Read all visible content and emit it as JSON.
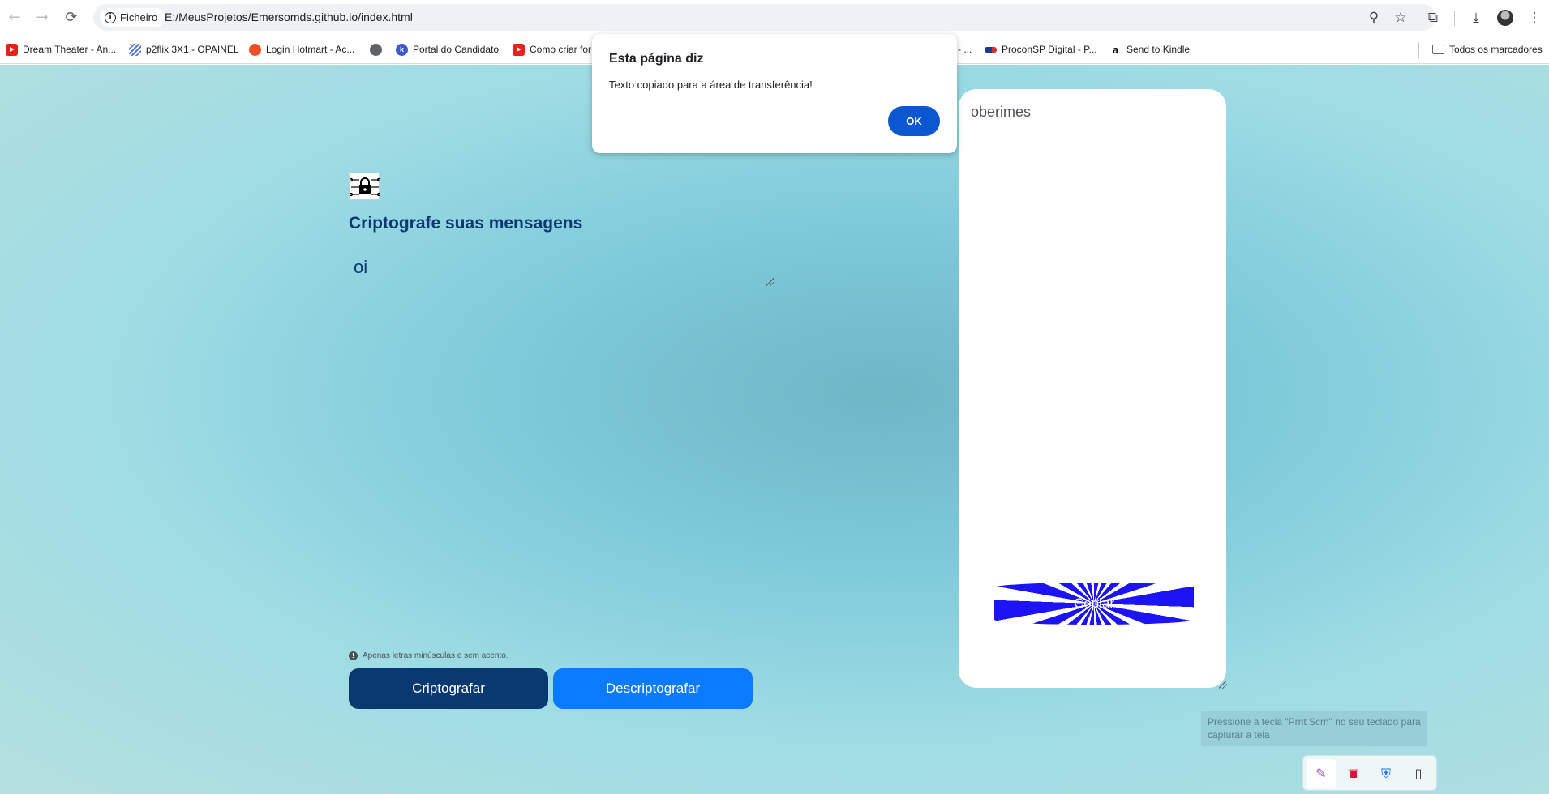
{
  "browser": {
    "nav": {
      "back": "←",
      "forward": "→",
      "reload": "⟳"
    },
    "site_chip": "Ficheiro",
    "url": "E:/MeusProjetos/Emersomds.github.io/index.html",
    "bookmarks": [
      {
        "label": "Dream Theater - An...",
        "icon": "youtube"
      },
      {
        "label": "p2flix 3X1 - OPAINEL",
        "icon": "stripes"
      },
      {
        "label": "Login Hotmart - Ac...",
        "icon": "hotmart"
      },
      {
        "label": "",
        "icon": "globe"
      },
      {
        "label": "Portal do Candidato",
        "icon": "portal"
      },
      {
        "label": "Como criar for",
        "icon": "youtube"
      },
      {
        "label": "- ...",
        "icon": "none"
      },
      {
        "label": "ProconSP Digital - P...",
        "icon": "procon"
      },
      {
        "label": "Send to Kindle",
        "icon": "amazon"
      }
    ],
    "all_bookmarks": "Todos os marcadores"
  },
  "app": {
    "title": "Criptografe suas mensagens",
    "input_value": "oi",
    "hint": "Apenas letras minúsculas e sem acento.",
    "encrypt_label": "Criptografar",
    "decrypt_label": "Descriptografar",
    "output_text": "oberimes",
    "copy_label": "Copiar"
  },
  "alert": {
    "title": "Esta página diz",
    "message": "Texto copiado para a área de transferência!",
    "ok_label": "OK"
  },
  "snipping": {
    "tooltip": "Pressione a tecla \"Prnt Scrn\" no seu teclado para capturar a tela"
  },
  "colors": {
    "primary_dark": "#0a3871",
    "primary_bright": "#0a7bff",
    "dialog_button": "#0b57d0"
  }
}
